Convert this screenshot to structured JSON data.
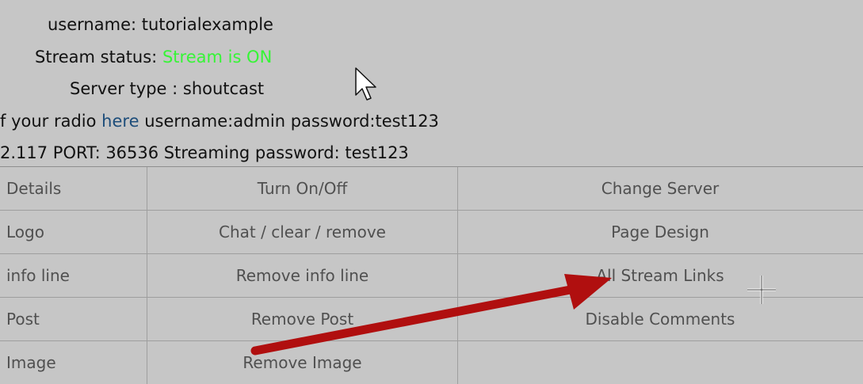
{
  "info": {
    "username_label": "username:",
    "username_value": "tutorialexample",
    "stream_status_label": "Stream status:",
    "stream_status_value": "Stream is ON",
    "server_type_label": "Server type :",
    "server_type_value": "shoutcast",
    "admin_prefix": "f your radio",
    "admin_link": "here",
    "admin_suffix": "username:admin password:test123",
    "port_line": "2.117 PORT: 36536 Streaming password: test123"
  },
  "menu": {
    "rows": [
      [
        "Details",
        "Turn On/Off",
        "Change Server"
      ],
      [
        "Logo",
        "Chat / clear / remove",
        "Page Design"
      ],
      [
        "info line",
        "Remove info line",
        "All Stream Links"
      ],
      [
        "Post",
        "Remove Post",
        "Disable Comments"
      ],
      [
        "Image",
        "Remove Image",
        ""
      ]
    ]
  },
  "colors": {
    "status_on": "#36f536",
    "arrow": "#b00f0f"
  },
  "icons": {
    "cursor": "arrow-cursor-icon",
    "crosshair": "crosshair-cursor-icon"
  }
}
